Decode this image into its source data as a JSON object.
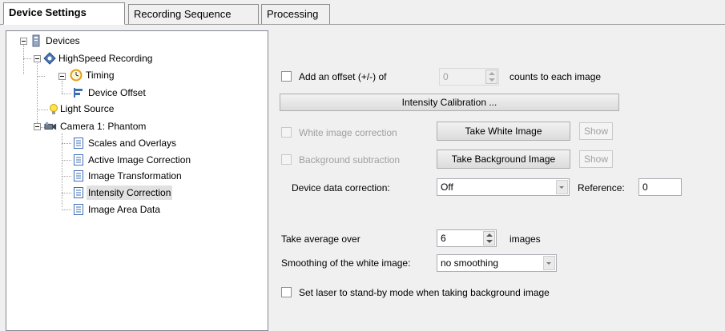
{
  "tabs": [
    {
      "label": "Device Settings",
      "active": true
    },
    {
      "label": "Recording Sequence",
      "active": false
    },
    {
      "label": "Processing",
      "active": false
    }
  ],
  "tree": {
    "devices": "Devices",
    "highspeed": "HighSpeed Recording",
    "timing": "Timing",
    "device_offset": "Device Offset",
    "light_source": "Light Source",
    "camera": "Camera 1: Phantom",
    "scales": "Scales and Overlays",
    "active_correction": "Active Image Correction",
    "transformation": "Image Transformation",
    "intensity_correction": "Intensity Correction",
    "area_data": "Image Area Data",
    "selected": "Intensity Correction"
  },
  "offset": {
    "label": "Add an offset (+/-) of",
    "value": "0",
    "suffix": "counts to each image",
    "checked": false
  },
  "calibration_button": "Intensity Calibration ...",
  "white": {
    "label": "White image correction",
    "button": "Take White Image",
    "show": "Show",
    "enabled": false
  },
  "background": {
    "label": "Background subtraction",
    "button": "Take Background Image",
    "show": "Show",
    "enabled": false
  },
  "device_data": {
    "label": "Device data correction:",
    "value": "Off",
    "reference_label": "Reference:",
    "reference_value": "0"
  },
  "average": {
    "label": "Take average over",
    "value": "6",
    "suffix": "images"
  },
  "smoothing": {
    "label": "Smoothing of the white image:",
    "value": "no smoothing"
  },
  "laser": {
    "label": "Set laser to stand-by mode when taking background image",
    "checked": false
  },
  "colors": {
    "selection": "#e1e1e1",
    "panel_border": "#828790",
    "disabled_text": "#a0a0a0"
  }
}
